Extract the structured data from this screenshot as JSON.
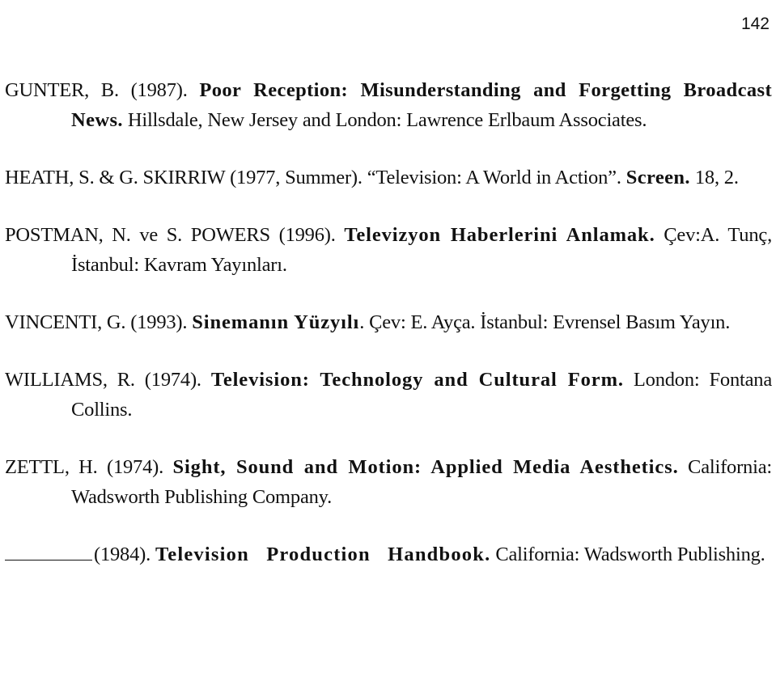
{
  "page": {
    "number": "142"
  },
  "references": [
    {
      "author": "GUNTER, B. (1987). ",
      "title": "Poor Reception: Misunderstanding and Forgetting Broadcast News.",
      "rest": " Hillsdale, New Jersey and London: Lawrence Erlbaum Associates."
    },
    {
      "author": "HEATH, S. & G. SKIRRIW (1977, Summer). “Television: A World in Action”. ",
      "title": "Screen.",
      "rest": " 18, 2."
    },
    {
      "author": "POSTMAN, N. ve S. POWERS (1996). ",
      "title": "Televizyon Haberlerini Anlamak.",
      "rest": " Çev:A. Tunç, İstanbul: Kavram Yayınları."
    },
    {
      "author": "VINCENTI, G. (1993). ",
      "title": "Sinemanın Yüzyılı",
      "rest": ". Çev: E. Ayça. İstanbul: Evrensel Basım Yayın."
    },
    {
      "author": "WILLIAMS, R. (1974). ",
      "title": "Television: Technology and Cultural Form.",
      "rest": " London: Fontana Collins."
    },
    {
      "author": "ZETTL, H. (1974). ",
      "title": "Sight, Sound and Motion: Applied Media Aesthetics.",
      "rest": " California: Wadsworth Publishing Company."
    },
    {
      "author": "(1984). ",
      "title": "Television Production Handbook.",
      "rest": " California: Wadsworth Publishing.",
      "ditto_author": true
    }
  ]
}
